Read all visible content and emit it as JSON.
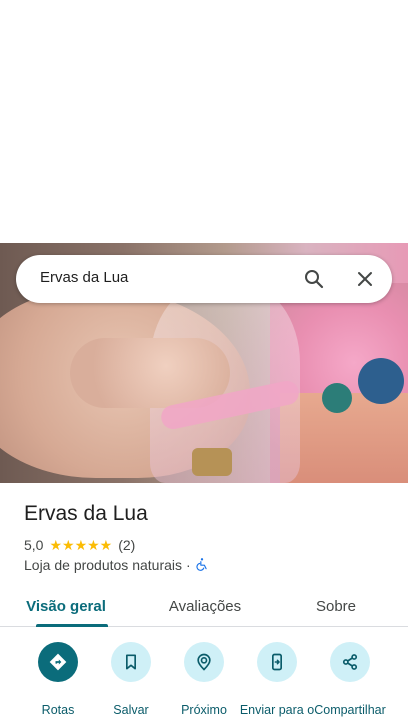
{
  "search": {
    "query": "Ervas da Lua"
  },
  "place": {
    "name": "Ervas da Lua",
    "rating": "5,0",
    "stars": "★★★★★",
    "review_count": "(2)",
    "category": "Loja de produtos naturais",
    "separator": "·"
  },
  "tabs": [
    {
      "label": "Visão geral",
      "selected": true
    },
    {
      "label": "Avaliações",
      "selected": false
    },
    {
      "label": "Sobre",
      "selected": false
    }
  ],
  "actions": [
    {
      "label": "Rotas",
      "icon": "directions-icon"
    },
    {
      "label": "Salvar",
      "icon": "bookmark-icon"
    },
    {
      "label": "Próximo",
      "icon": "nearby-icon"
    },
    {
      "label": "Enviar para o",
      "icon": "send-to-phone-icon"
    },
    {
      "label": "Compartilhar",
      "icon": "share-icon"
    }
  ],
  "colors": {
    "accent": "#0b6c7b",
    "action_bg": "#cff0f7",
    "star": "#fbbc04",
    "wheelchair": "#1a73e8"
  }
}
